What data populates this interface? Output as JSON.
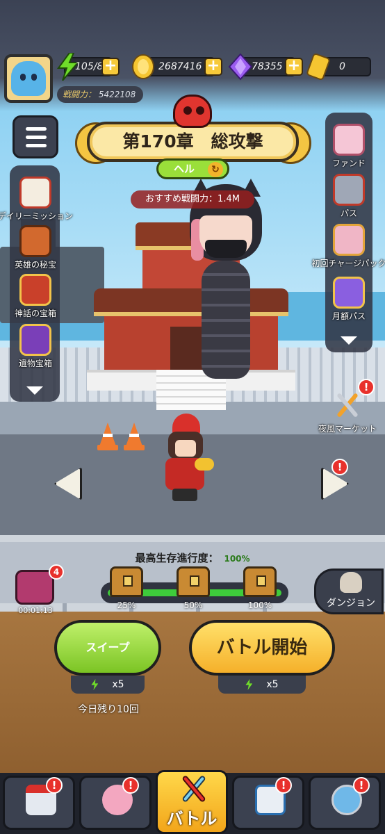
{
  "top_bar": {
    "energy": "105/80",
    "gold": "2687416",
    "gems": "78355",
    "tickets": "0",
    "power_label": "戦闘力：",
    "power_value": "5422108"
  },
  "chapter": {
    "title": "第170章　総攻撃",
    "difficulty": "ヘル",
    "recommended_power": "おすすめ戦闘力：1.4M"
  },
  "left_menu": [
    {
      "label": "デイリーミッション",
      "icon": "calendar-icon"
    },
    {
      "label": "英雄の秘宝",
      "icon": "hero-treasure-icon"
    },
    {
      "label": "神話の宝箱",
      "icon": "myth-chest-icon"
    },
    {
      "label": "遺物宝箱",
      "icon": "relic-chest-icon"
    }
  ],
  "right_menu": [
    {
      "label": "ファンド",
      "icon": "piggy-bank-icon"
    },
    {
      "label": "パス",
      "icon": "pass-icon"
    },
    {
      "label": "初回チャージパック",
      "icon": "first-charge-icon"
    },
    {
      "label": "月額パス",
      "icon": "monthly-pass-icon"
    }
  ],
  "night_market": {
    "label": "夜風マーケット",
    "badge": "!"
  },
  "progress": {
    "title": "最高生存進行度：",
    "value": "100%",
    "fill_percent": 100,
    "milestones": [
      "25%",
      "50%",
      "100%"
    ]
  },
  "idle_reward": {
    "count": "4",
    "timer": "00:01:13"
  },
  "dungeon": {
    "label": "ダンジョン"
  },
  "sweep": {
    "label": "スイープ",
    "cost": "x5",
    "remaining": "今日残り10回"
  },
  "battle": {
    "label": "バトル開始",
    "cost": "x5"
  },
  "bottom_nav": [
    {
      "name": "shop",
      "label": "",
      "badge": "!"
    },
    {
      "name": "nurse",
      "label": "",
      "badge": "!"
    },
    {
      "name": "battle",
      "label": "バトル",
      "badge": ""
    },
    {
      "name": "medkit",
      "label": "",
      "badge": "!"
    },
    {
      "name": "emblem",
      "label": "",
      "badge": "!"
    }
  ],
  "colors": {
    "accent_gold": "#f7c93a",
    "alert_red": "#e8312c",
    "sweep_green": "#7bc424",
    "battle_yellow": "#f5b02a"
  }
}
